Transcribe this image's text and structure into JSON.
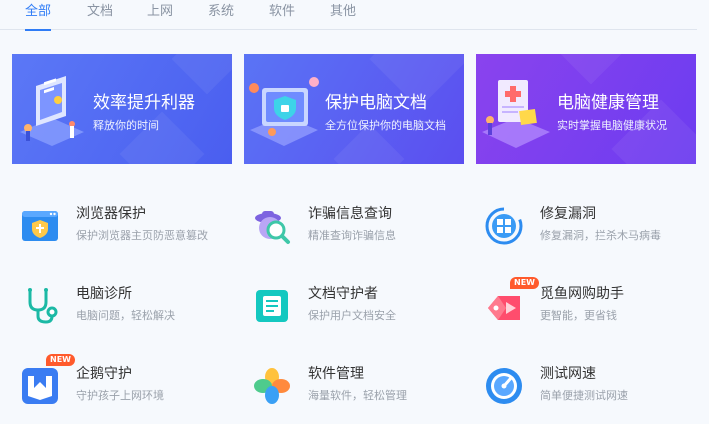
{
  "tabs": [
    {
      "label": "全部"
    },
    {
      "label": "文档"
    },
    {
      "label": "上网"
    },
    {
      "label": "系统"
    },
    {
      "label": "软件"
    },
    {
      "label": "其他"
    }
  ],
  "banners": [
    {
      "title": "效率提升利器",
      "subtitle": "释放你的时间"
    },
    {
      "title": "保护电脑文档",
      "subtitle": "全方位保护你的电脑文档"
    },
    {
      "title": "电脑健康管理",
      "subtitle": "实时掌握电脑健康状况"
    }
  ],
  "tools": [
    {
      "name": "浏览器保护",
      "desc": "保护浏览器主页防恶意篡改",
      "icon": "browser-shield-icon"
    },
    {
      "name": "诈骗信息查询",
      "desc": "精准查询诈骗信息",
      "icon": "fraud-search-icon"
    },
    {
      "name": "修复漏洞",
      "desc": "修复漏洞，拦杀木马病毒",
      "icon": "windows-repair-icon"
    },
    {
      "name": "电脑诊所",
      "desc": "电脑问题，轻松解决",
      "icon": "stethoscope-icon"
    },
    {
      "name": "文档守护者",
      "desc": "保护用户文档安全",
      "icon": "document-guard-icon"
    },
    {
      "name": "觅鱼网购助手",
      "desc": "更智能，更省钱",
      "icon": "shopping-tag-icon",
      "badge": "NEW"
    },
    {
      "name": "企鹅守护",
      "desc": "守护孩子上网环境",
      "icon": "penguin-guard-icon",
      "badge": "NEW"
    },
    {
      "name": "软件管理",
      "desc": "海量软件，轻松管理",
      "icon": "software-clover-icon"
    },
    {
      "name": "测试网速",
      "desc": "简单便捷测试网速",
      "icon": "speedometer-icon"
    }
  ]
}
